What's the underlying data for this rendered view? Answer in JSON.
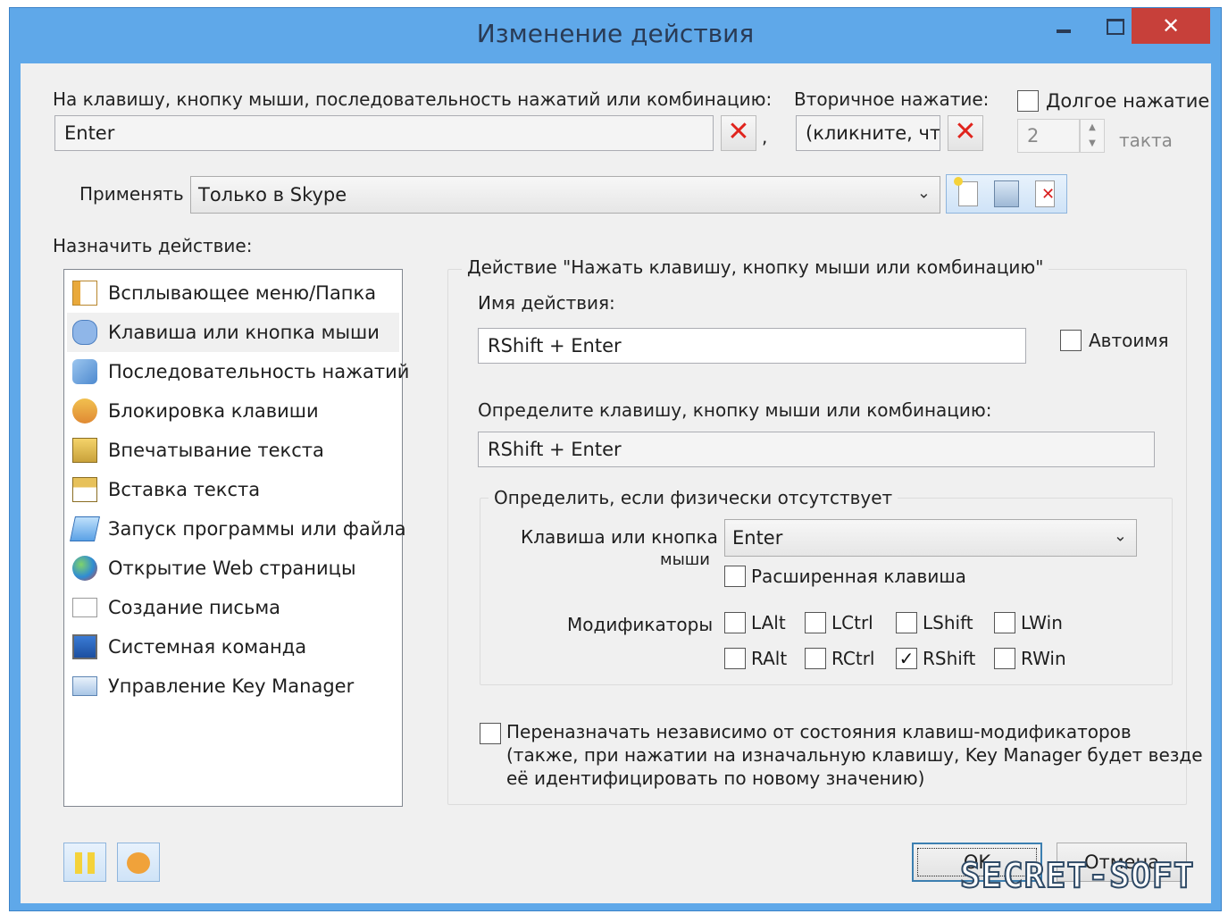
{
  "window": {
    "title": "Изменение действия",
    "close_glyph": "✕"
  },
  "trigger": {
    "label": "На клавишу, кнопку мыши, последовательность нажатий или комбинацию:",
    "value": "Enter",
    "comma": ","
  },
  "secondary": {
    "label": "Вторичное нажатие:",
    "value": "(кликните, что"
  },
  "long_press": {
    "label": "Долгое нажатие",
    "checked": false,
    "ticks_value": "2",
    "ticks_unit": "такта"
  },
  "apply": {
    "label": "Применять",
    "selected": "Только в Skype"
  },
  "assign": {
    "label": "Назначить действие:",
    "items": [
      {
        "label": "Всплывающее меню/Папка",
        "icon": "menu-folder-icon"
      },
      {
        "label": "Клавиша или кнопка мыши",
        "icon": "key-icon",
        "selected": true
      },
      {
        "label": "Последовательность нажатий",
        "icon": "sequence-icon"
      },
      {
        "label": "Блокировка клавиши",
        "icon": "lock-key-icon"
      },
      {
        "label": "Впечатывание текста",
        "icon": "type-text-icon"
      },
      {
        "label": "Вставка текста",
        "icon": "paste-text-icon"
      },
      {
        "label": "Запуск программы или файла",
        "icon": "run-program-icon"
      },
      {
        "label": "Открытие Web страницы",
        "icon": "globe-icon"
      },
      {
        "label": "Создание письма",
        "icon": "mail-icon"
      },
      {
        "label": "Системная команда",
        "icon": "system-command-icon"
      },
      {
        "label": "Управление Key Manager",
        "icon": "key-manager-icon"
      }
    ]
  },
  "action_group": {
    "caption": "Действие \"Нажать клавишу, кнопку мыши или комбинацию\"",
    "name_label": "Имя действия:",
    "name_value": "RShift + Enter",
    "autoname_label": "Автоимя",
    "define_label": "Определите клавишу, кнопку мыши или комбинацию:",
    "define_value": "RShift + Enter"
  },
  "physical_group": {
    "caption": "Определить, если физически отсутствует",
    "key_label_line1": "Клавиша или кнопка",
    "key_label_line2": "мыши",
    "key_value": "Enter",
    "extended_label": "Расширенная клавиша",
    "modifiers_label": "Модификаторы",
    "modifiers": [
      {
        "label": "LAlt",
        "checked": false
      },
      {
        "label": "LCtrl",
        "checked": false
      },
      {
        "label": "LShift",
        "checked": false
      },
      {
        "label": "LWin",
        "checked": false
      },
      {
        "label": "RAlt",
        "checked": false
      },
      {
        "label": "RCtrl",
        "checked": false
      },
      {
        "label": "RShift",
        "checked": true
      },
      {
        "label": "RWin",
        "checked": false
      }
    ]
  },
  "remap": {
    "line1": "Переназначать независимо от состояния клавиш-модификаторов",
    "line2": "(также, при нажатии на изначальную клавишу, Key Manager будет везде",
    "line3": "её идентифицировать по новому значению)",
    "checked": false
  },
  "buttons": {
    "ok": "OK",
    "cancel": "Отмена"
  },
  "watermark": "SECRET-SOFT",
  "glyphs": {
    "x": "✕",
    "check": "✓",
    "chevron": "⌄",
    "up": "▲",
    "down": "▼"
  },
  "colors": {
    "titlebar": "#5fa8e9",
    "close": "#c7403a",
    "client": "#f0f0f0",
    "red_x": "#e0231c"
  }
}
